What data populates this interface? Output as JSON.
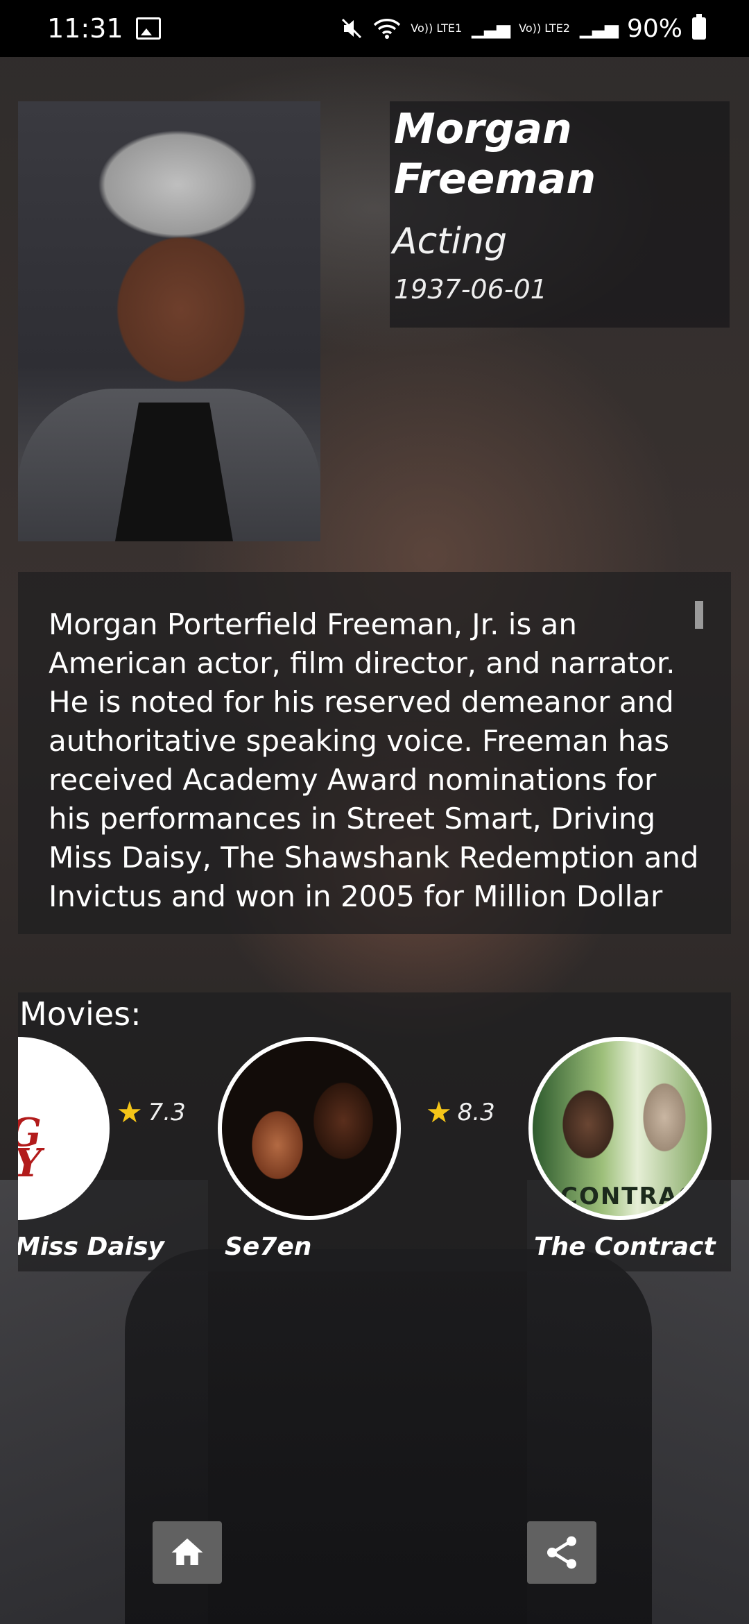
{
  "status_bar": {
    "time": "11:31",
    "network_1": "Vo)) LTE1",
    "network_2": "Vo)) LTE2",
    "battery": "90%"
  },
  "actor": {
    "name": "Morgan Freeman",
    "department": "Acting",
    "birthday": "1937-06-01",
    "biography": "Morgan Porterfield Freeman, Jr. is an American actor, film director, and narrator. He is noted for his reserved demeanor and authoritative speaking voice. Freeman has received Academy Award nominations for his performances in Street Smart, Driving Miss Daisy, The Shawshank Redemption and Invictus and won in 2005 for Million Dollar"
  },
  "movies": {
    "label": "Movies:",
    "items": [
      {
        "title": "Driving Miss Daisy",
        "title_visible": "Miss Daisy",
        "rating": "7.3",
        "poster_text": "NG\nAISY"
      },
      {
        "title": "Se7en",
        "rating": "8.3"
      },
      {
        "title": "The Contract",
        "poster_text": "CONTRACT"
      }
    ]
  },
  "buttons": {
    "home_icon": "home-icon",
    "share_icon": "share-icon"
  },
  "colors": {
    "star": "#f5c518",
    "panel": "rgba(30,30,32,0.72)",
    "button": "#6e6e6e"
  }
}
